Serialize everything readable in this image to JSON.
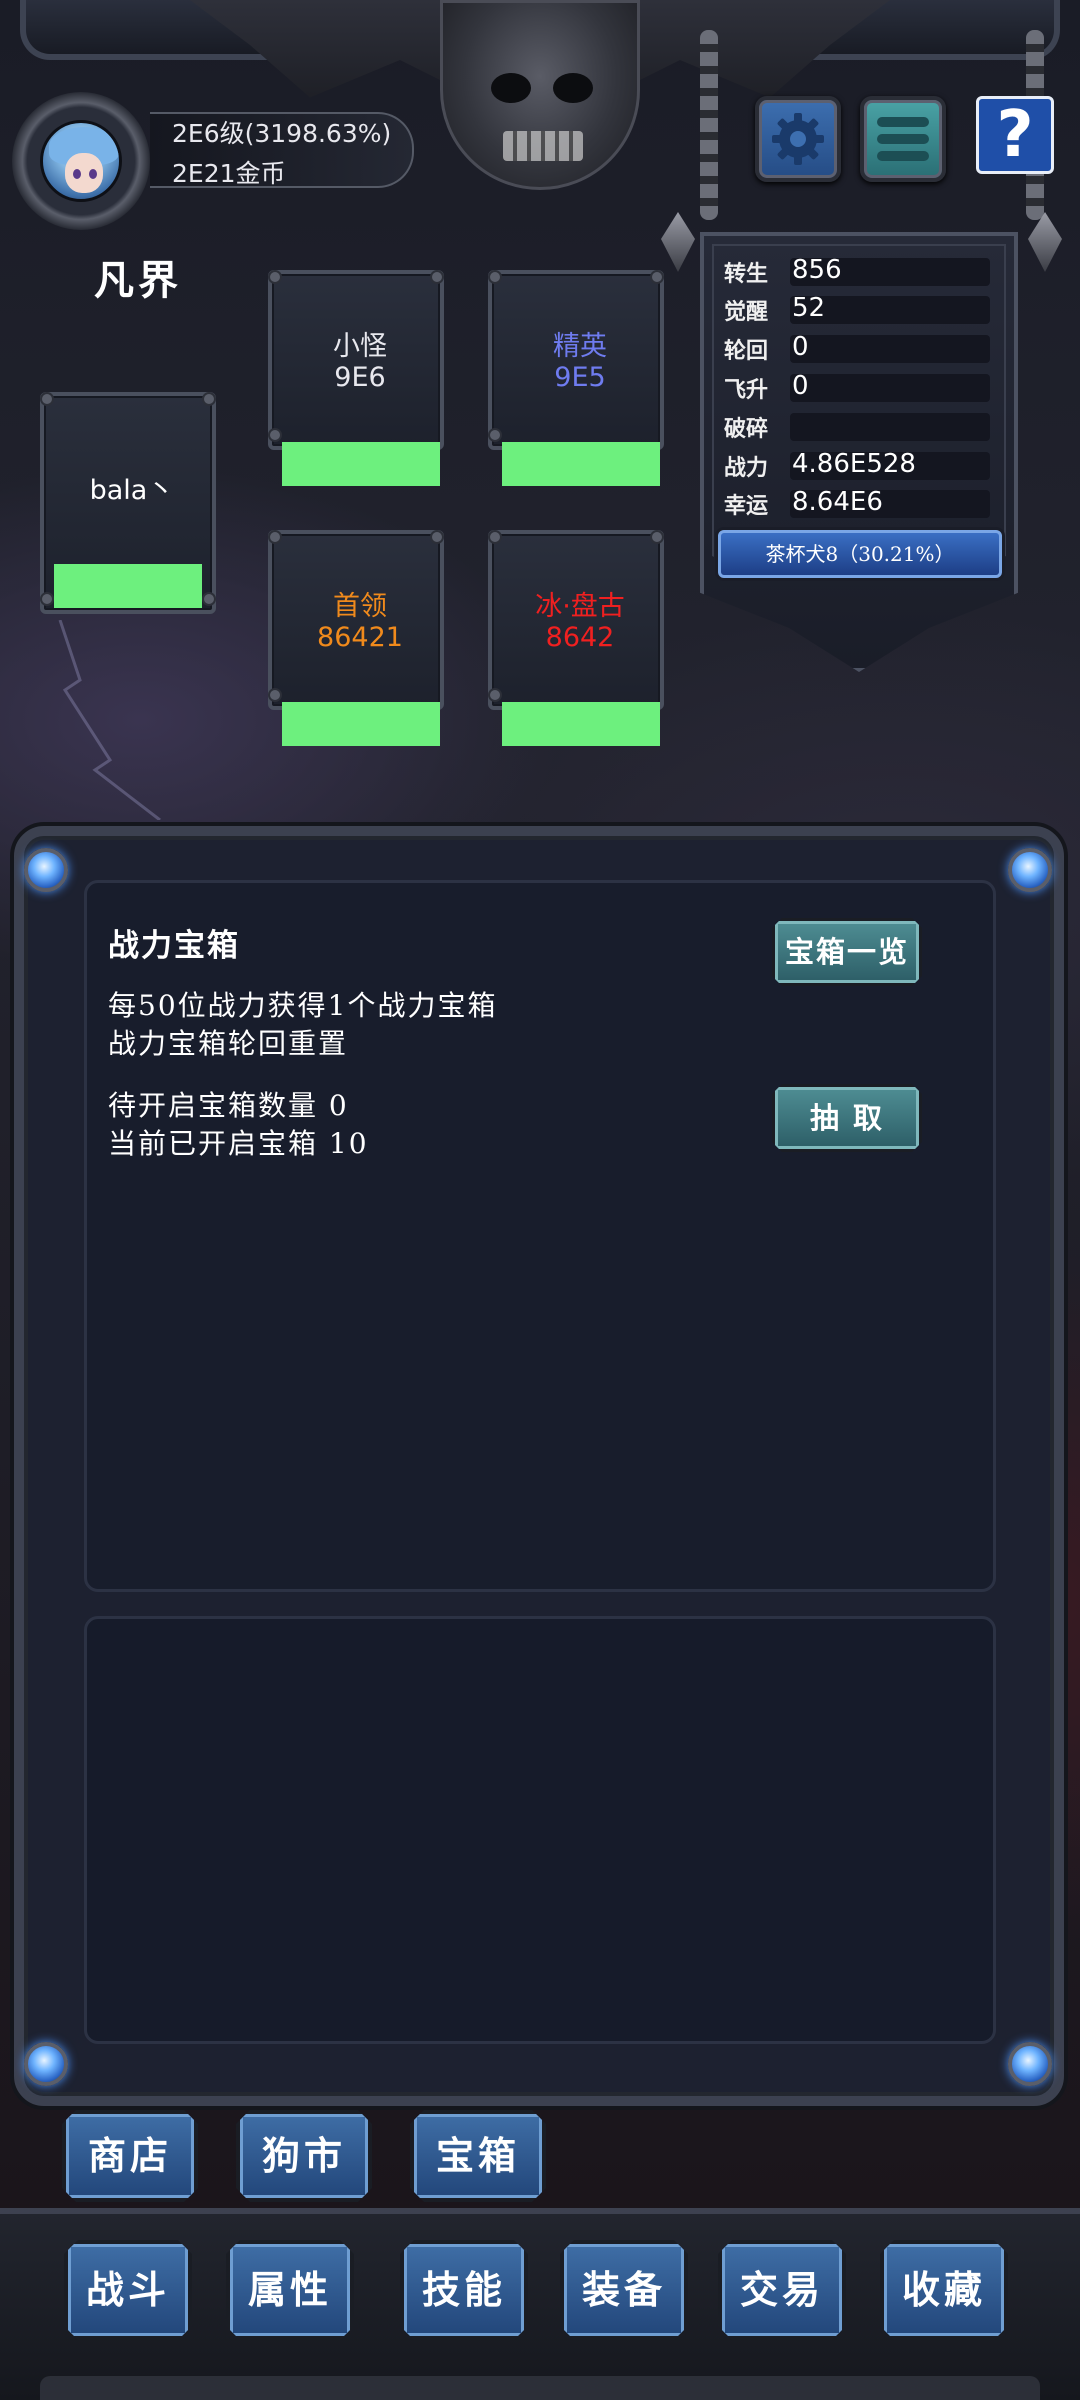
{
  "player": {
    "level": "2E6级(3198.63%)",
    "gold": "2E21金币",
    "realm": "凡界"
  },
  "top_buttons": {
    "settings_icon": "gear-icon",
    "menu_icon": "menu-icon",
    "help": "?"
  },
  "stats": {
    "rebirth_label": "转生",
    "rebirth": "856",
    "awaken_label": "觉醒",
    "awaken": "52",
    "cycle_label": "轮回",
    "cycle": "0",
    "ascend_label": "飞升",
    "ascend": "0",
    "shatter_label": "破碎",
    "shatter": "",
    "power_label": "战力",
    "power": "4.86E528",
    "luck_label": "幸运",
    "luck": "8.64E6",
    "pet": "茶杯犬8（30.21%）"
  },
  "enemies": {
    "self": {
      "name": "bala丶",
      "hp_fraction": 1.0
    },
    "minion": {
      "name": "小怪",
      "value": "9E6",
      "color": "#e8e8ee",
      "hp_fraction": 1.0
    },
    "elite": {
      "name": "精英",
      "value": "9E5",
      "color": "#6f7cf0",
      "hp_fraction": 1.0
    },
    "boss": {
      "name": "首领",
      "value": "86421",
      "color": "#f08a1c",
      "hp_fraction": 1.0
    },
    "ice": {
      "name": "冰·盘古",
      "value": "8642",
      "color": "#f02020",
      "hp_fraction": 1.0
    }
  },
  "chest_panel": {
    "title": "战力宝箱",
    "desc1": "每50位战力获得1个战力宝箱",
    "desc2": "战力宝箱轮回重置",
    "pending": "待开启宝箱数量 0",
    "opened": "当前已开启宝箱 10",
    "list_button": "宝箱一览",
    "draw_button": "抽 取"
  },
  "sub_tabs": [
    "商店",
    "狗市",
    "宝箱"
  ],
  "nav_tabs": [
    "战斗",
    "属性",
    "技能",
    "装备",
    "交易",
    "收藏"
  ],
  "colors": {
    "hp_green": "#6df07e",
    "tab_blue": "#3f6ea6",
    "teal_button": "#4f8e94"
  }
}
